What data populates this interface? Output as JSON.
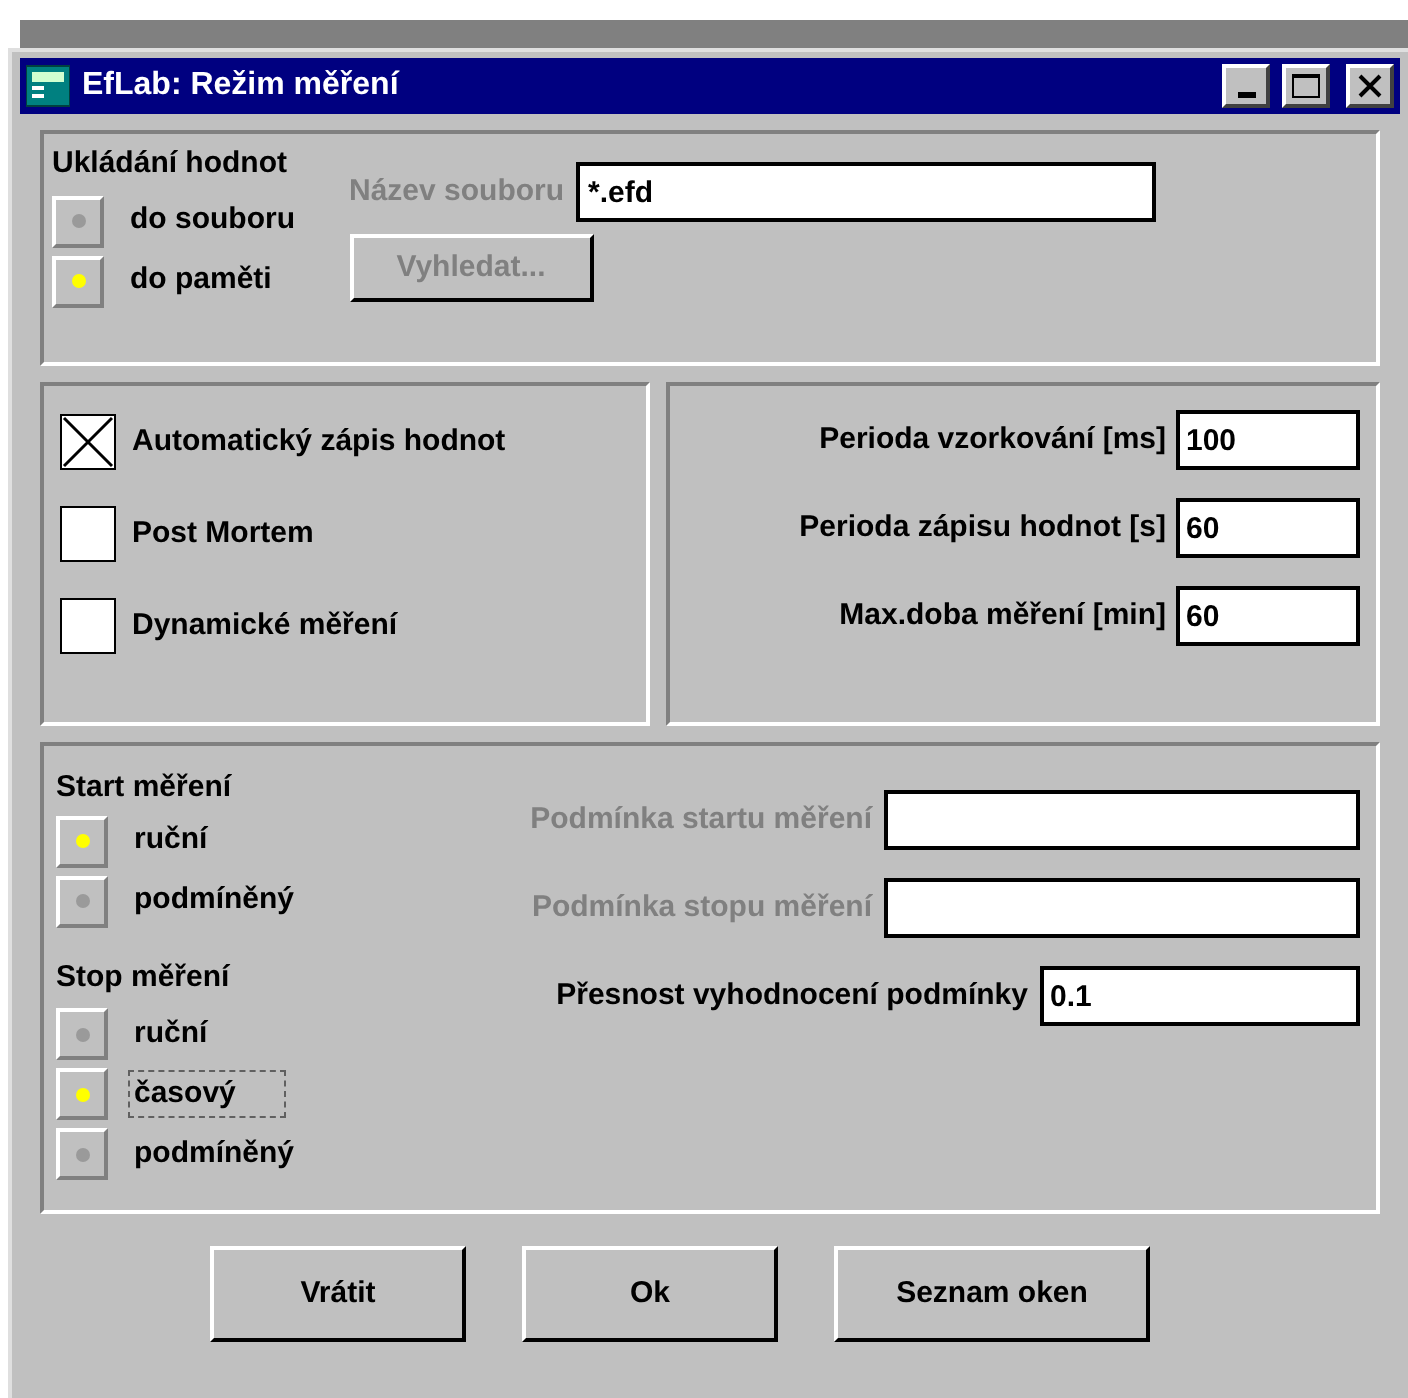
{
  "window": {
    "title": "EfLab: Režim měření"
  },
  "storage": {
    "heading": "Ukládání hodnot",
    "options": [
      {
        "label": "do souboru",
        "selected": false
      },
      {
        "label": "do paměti",
        "selected": true
      }
    ],
    "filename": {
      "label": "Název souboru",
      "value": "*.efd",
      "disabled": true
    },
    "browse": {
      "label": "Vyhledat...",
      "disabled": true
    }
  },
  "options": [
    {
      "label": "Automatický zápis hodnot",
      "checked": true
    },
    {
      "label": "Post Mortem",
      "checked": false
    },
    {
      "label": "Dynamické měření",
      "checked": false
    }
  ],
  "periods": [
    {
      "label": "Perioda vzorkování [ms]",
      "value": "100"
    },
    {
      "label": "Perioda zápisu hodnot [s]",
      "value": "60"
    },
    {
      "label": "Max.doba měření [min]",
      "value": "60"
    }
  ],
  "start": {
    "heading": "Start měření",
    "options": [
      {
        "label": "ruční",
        "selected": true,
        "focused": false
      },
      {
        "label": "podmíněný",
        "selected": false,
        "focused": false
      }
    ]
  },
  "stop": {
    "heading": "Stop měření",
    "options": [
      {
        "label": "ruční",
        "selected": false,
        "focused": false
      },
      {
        "label": "časový",
        "selected": true,
        "focused": true
      },
      {
        "label": "podmíněný",
        "selected": false,
        "focused": false
      }
    ]
  },
  "conditions": [
    {
      "label": "Podmínka startu měření",
      "disabled": true
    },
    {
      "label": "Podmínka stopu měření",
      "disabled": true
    },
    {
      "label": "Přesnost vyhodnocení podmínky",
      "value": "0.1",
      "disabled": false
    }
  ],
  "buttons": [
    "Vrátit",
    "Ok",
    "Seznam oken"
  ]
}
